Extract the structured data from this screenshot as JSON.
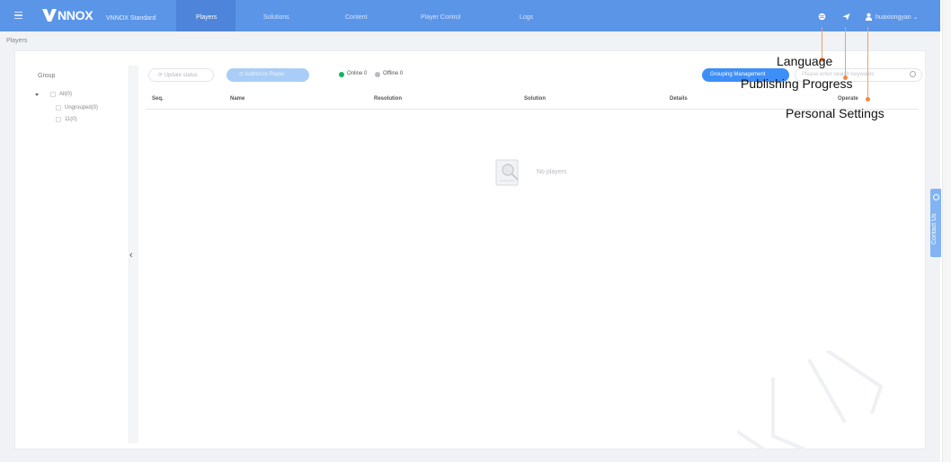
{
  "header": {
    "brand": "NNOX",
    "edition": "VNNOX Standard",
    "tabs": [
      {
        "label": "Players",
        "active": true
      },
      {
        "label": "Solutions",
        "active": false
      },
      {
        "label": "Content",
        "active": false
      },
      {
        "label": "Player Control",
        "active": false
      },
      {
        "label": "Logs",
        "active": false
      }
    ],
    "user": "huaxiongyan ⌄",
    "icons": [
      "menu-icon",
      "globe-icon",
      "paper-plane-icon",
      "user-icon"
    ],
    "colors": {
      "nav_bg": "#5b95e8",
      "primary": "#3e8ef7",
      "online": "#16b45c",
      "offline": "#b8bbc0"
    }
  },
  "breadcrumb": "Players",
  "sidebar": {
    "title": "Group",
    "tree": [
      {
        "label": "All(0)"
      },
      {
        "label": "Ungrouped(0)"
      },
      {
        "label": "11(0)"
      }
    ]
  },
  "toolbar": {
    "update_status": "Update status",
    "authorize_player": "Authorize Player",
    "online": "Online 0",
    "offline": "Offline 0",
    "grouping_management": "Grouping Management",
    "search_placeholder": "Please enter search keywords"
  },
  "table": {
    "columns": [
      "Seq.",
      "Name",
      "Resolution",
      "Solution",
      "Details",
      "Operate"
    ],
    "empty_text": "No players"
  },
  "contact_us": "Contact Us",
  "annotations": {
    "language": "Language",
    "publishing_progress": "Publishing Progress",
    "personal_settings": "Personal Settings"
  }
}
